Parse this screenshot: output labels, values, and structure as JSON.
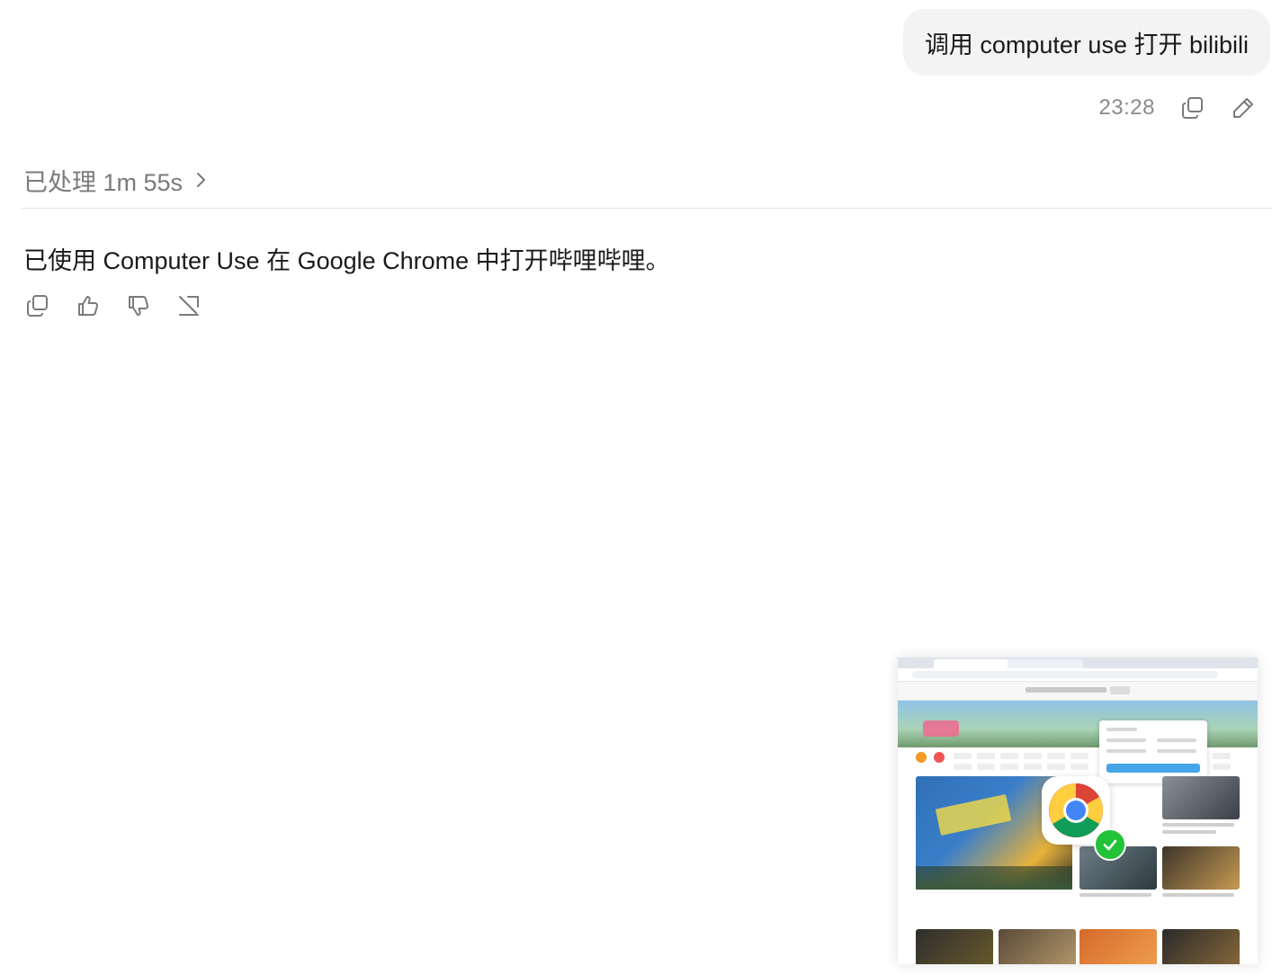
{
  "user_message": {
    "text": "调用 computer use 打开 bilibili",
    "time": "23:28"
  },
  "processed": {
    "label": "已处理 1m 55s"
  },
  "assistant_message": {
    "text": "已使用 Computer Use 在 Google Chrome 中打开哔哩哔哩。"
  },
  "icons": {
    "user_actions": [
      "copy-icon",
      "edit-icon"
    ],
    "assistant_actions": [
      "copy-icon",
      "thumbs-up-icon",
      "thumbs-down-icon",
      "share-icon"
    ],
    "processed": "chevron-right-icon",
    "thumbnail_badge": [
      "chrome-icon",
      "check-icon"
    ]
  },
  "colors": {
    "bubble_bg": "#f3f3f3",
    "muted_text": "#8a8a8a",
    "divider": "#e4e4e4",
    "check_green": "#22c338"
  }
}
